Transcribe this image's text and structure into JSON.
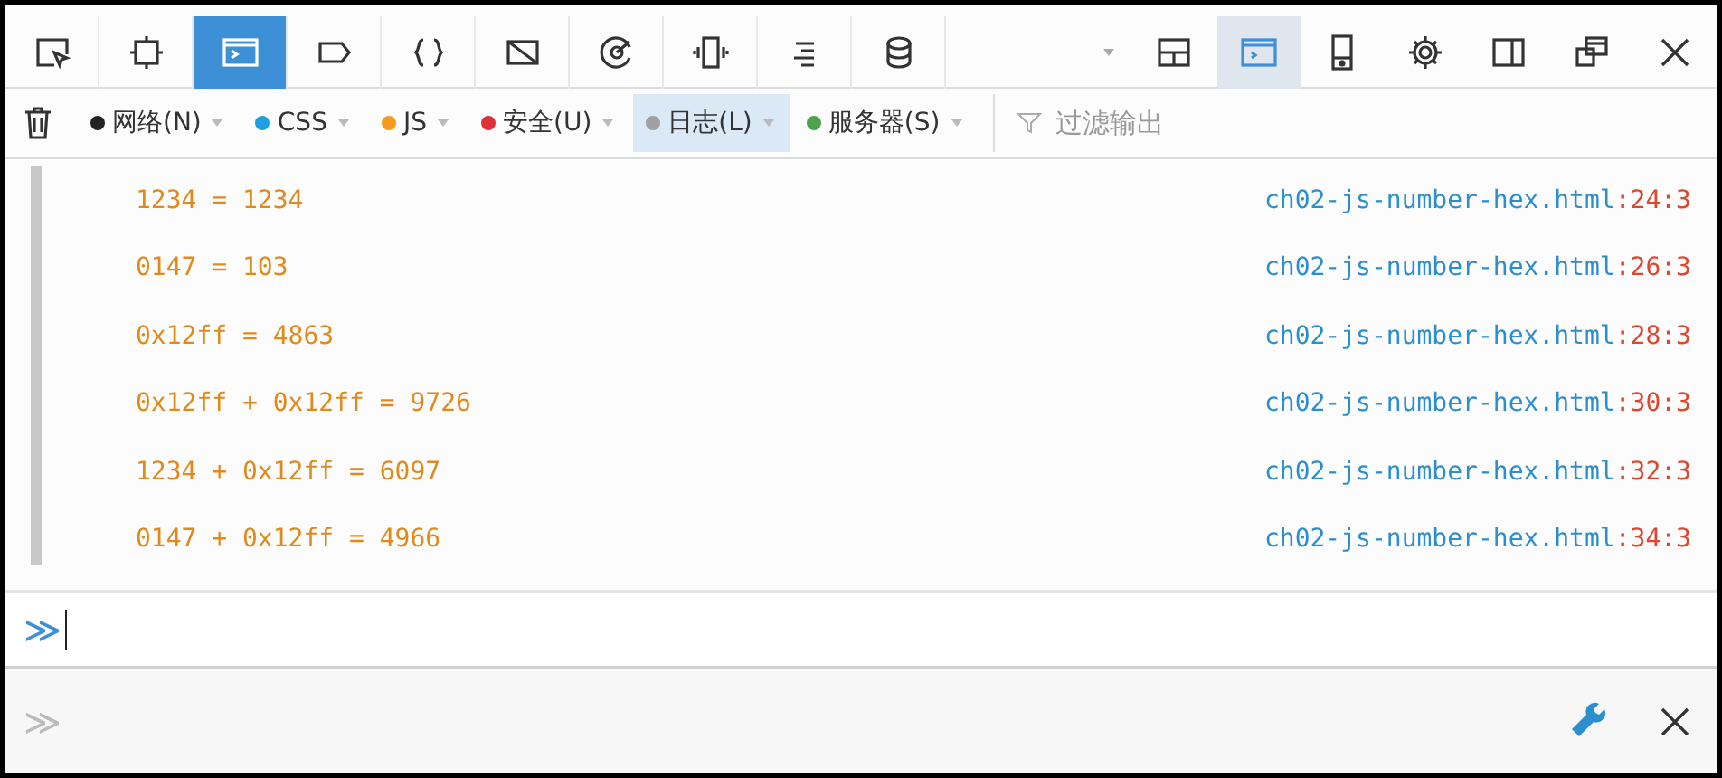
{
  "toolbar": {
    "tools": [
      {
        "kind": "pick",
        "selected": false
      },
      {
        "kind": "frame",
        "selected": false
      },
      {
        "kind": "console",
        "selected": true
      },
      {
        "kind": "tag",
        "selected": false
      },
      {
        "kind": "braces",
        "selected": false
      },
      {
        "kind": "crossed",
        "selected": false
      },
      {
        "kind": "gauge",
        "selected": false
      },
      {
        "kind": "vibrate",
        "selected": false
      },
      {
        "kind": "lines",
        "selected": false
      },
      {
        "kind": "database",
        "selected": false
      }
    ],
    "window_buttons": [
      {
        "kind": "caret",
        "on": false
      },
      {
        "kind": "split",
        "on": false
      },
      {
        "kind": "console",
        "on": true
      },
      {
        "kind": "phone",
        "on": false
      },
      {
        "kind": "gear",
        "on": false
      },
      {
        "kind": "sidebar",
        "on": false
      },
      {
        "kind": "undock",
        "on": false
      },
      {
        "kind": "close",
        "on": false
      }
    ]
  },
  "filter_bar": {
    "filters": [
      {
        "label": "网络(N)",
        "color": "#222222",
        "selected": false
      },
      {
        "label": "CSS",
        "color": "#1ea0e0",
        "selected": false
      },
      {
        "label": "JS",
        "color": "#f59a1c",
        "selected": false
      },
      {
        "label": "安全(U)",
        "color": "#e0303a",
        "selected": false
      },
      {
        "label": "日志(L)",
        "color": "#a0a0a0",
        "selected": true
      },
      {
        "label": "服务器(S)",
        "color": "#4ca34c",
        "selected": false
      }
    ],
    "search": {
      "placeholder": "过滤输出"
    }
  },
  "messages": [
    {
      "text": "1234 = 1234",
      "file": "ch02-js-number-hex.html",
      "position": ":24:3"
    },
    {
      "text": "0147 = 103",
      "file": "ch02-js-number-hex.html",
      "position": ":26:3"
    },
    {
      "text": "0x12ff = 4863",
      "file": "ch02-js-number-hex.html",
      "position": ":28:3"
    },
    {
      "text": "0x12ff + 0x12ff = 9726",
      "file": "ch02-js-number-hex.html",
      "position": ":30:3"
    },
    {
      "text": "1234 + 0x12ff = 6097",
      "file": "ch02-js-number-hex.html",
      "position": ":32:3"
    },
    {
      "text": "0147 + 0x12ff = 4966",
      "file": "ch02-js-number-hex.html",
      "position": ":34:3"
    }
  ],
  "input": {
    "prompt": "≫"
  },
  "bottom_bar": {
    "prompt": "≫"
  }
}
